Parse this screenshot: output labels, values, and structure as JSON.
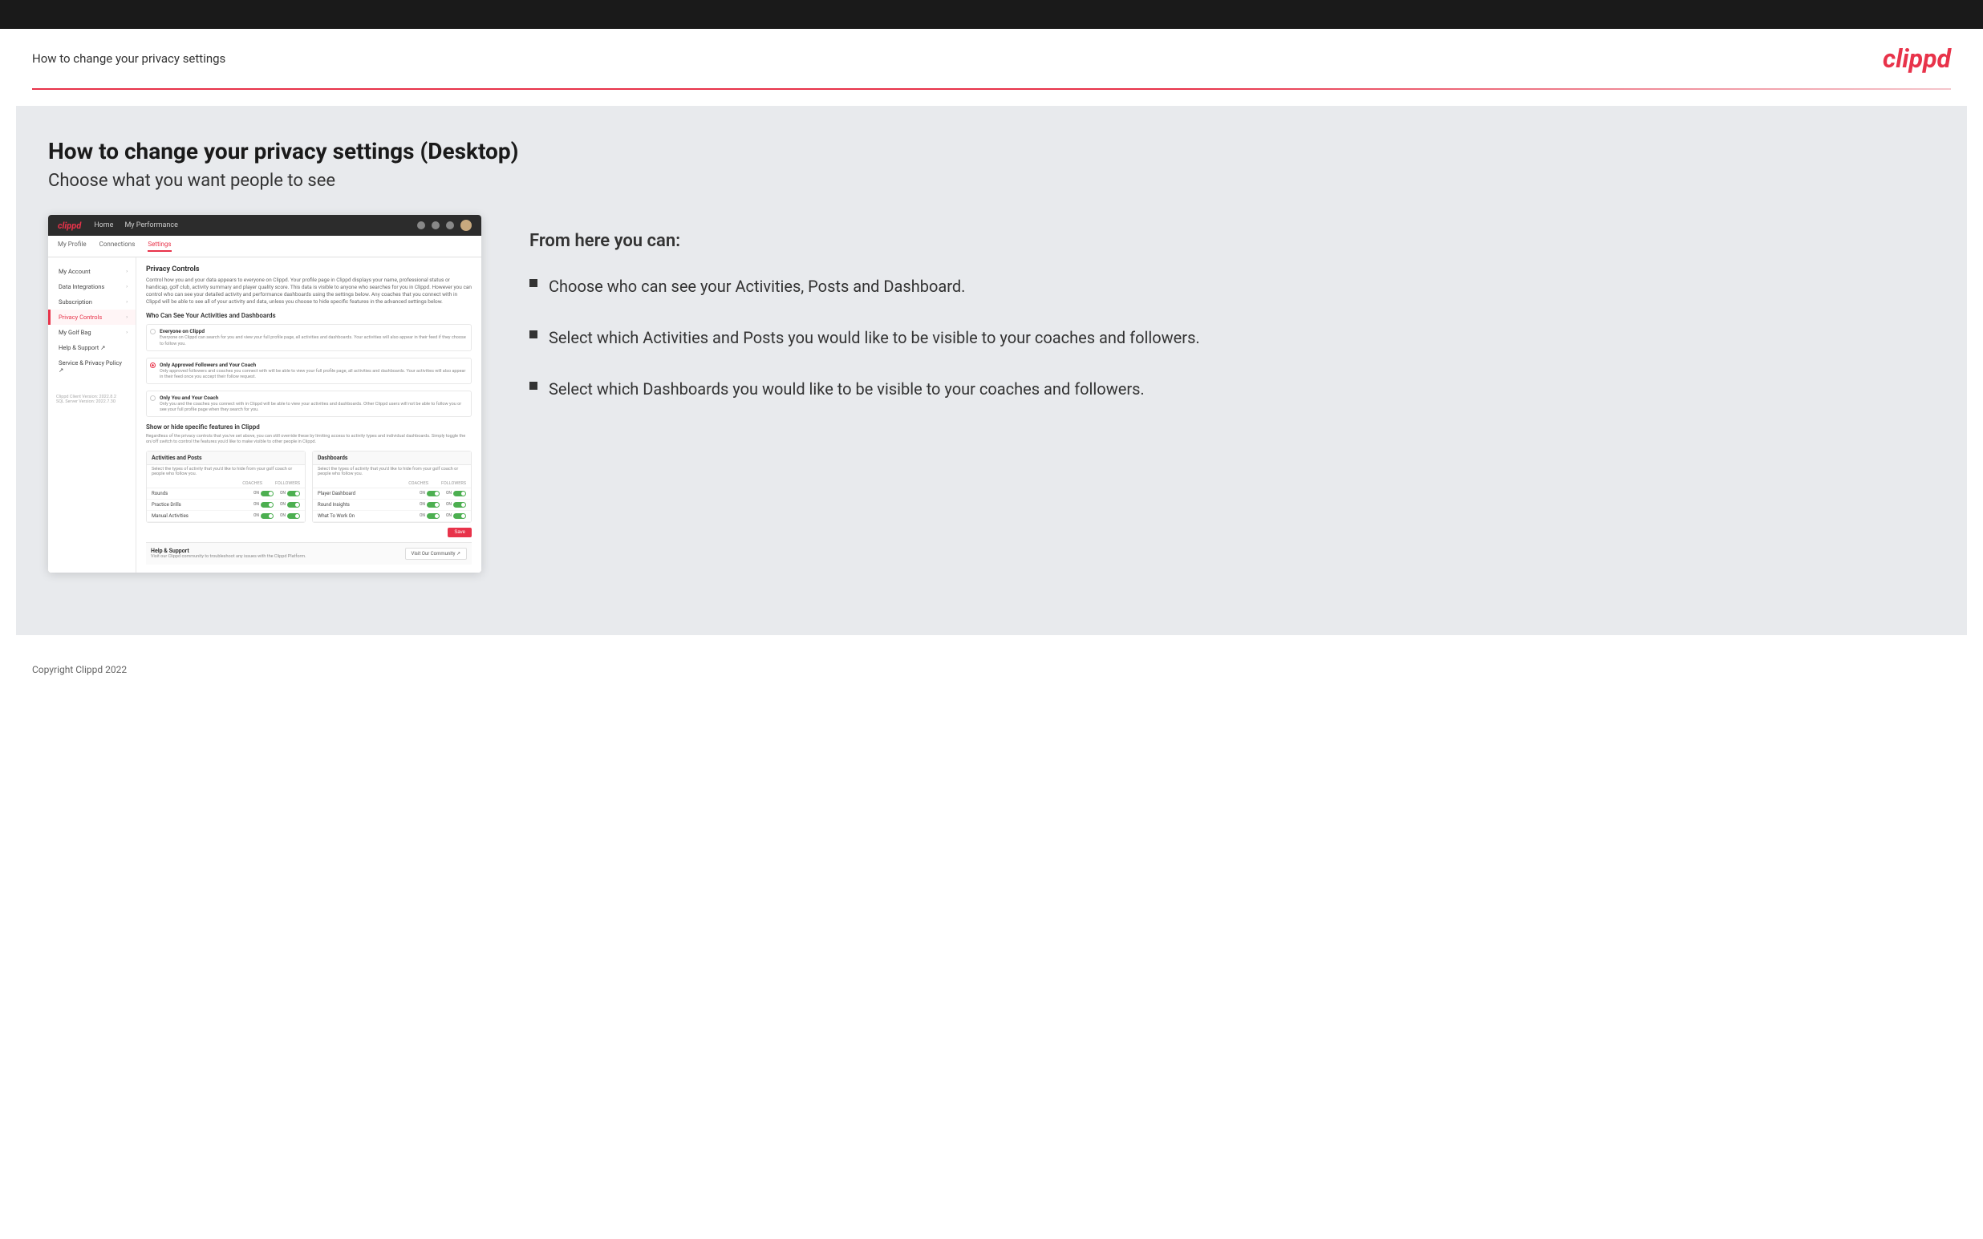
{
  "topBar": {},
  "header": {
    "title": "How to change your privacy settings",
    "logo": "clippd"
  },
  "main": {
    "pageTitle": "How to change your privacy settings (Desktop)",
    "pageSubtitle": "Choose what you want people to see",
    "rightPanel": {
      "fromHereTitle": "From here you can:",
      "bullets": [
        "Choose who can see your Activities, Posts and Dashboard.",
        "Select which Activities and Posts you would like to be visible to your coaches and followers.",
        "Select which Dashboards you would like to be visible to your coaches and followers."
      ]
    }
  },
  "mockup": {
    "navbar": {
      "logo": "clippd",
      "links": [
        "Home",
        "My Performance"
      ]
    },
    "subnav": {
      "items": [
        "My Profile",
        "Connections",
        "Settings"
      ]
    },
    "sidebar": {
      "items": [
        {
          "label": "My Account",
          "active": false
        },
        {
          "label": "Data Integrations",
          "active": false
        },
        {
          "label": "Subscription",
          "active": false
        },
        {
          "label": "Privacy Controls",
          "active": true
        },
        {
          "label": "My Golf Bag",
          "active": false
        },
        {
          "label": "Help & Support",
          "active": false
        },
        {
          "label": "Service & Privacy Policy",
          "active": false
        }
      ],
      "version": "Clippd Client Version: 2022.8.2\nSQL Server Version: 2022.7.30"
    },
    "privacyControls": {
      "sectionTitle": "Privacy Controls",
      "sectionDesc": "Control how you and your data appears to everyone on Clippd. Your profile page in Clippd displays your name, professional status or handicap, golf club, activity summary and player quality score. This data is visible to anyone who searches for you in Clippd. However you can control who can see your detailed activity and performance dashboards using the settings below. Any coaches that you connect with in Clippd will be able to see all of your activity and data, unless you choose to hide specific features in the advanced settings below.",
      "whoTitle": "Who Can See Your Activities and Dashboards",
      "radioOptions": [
        {
          "label": "Everyone on Clippd",
          "desc": "Everyone on Clippd can search for you and view your full profile page, all activities and dashboards. Your activities will also appear in their feed if they choose to follow you.",
          "selected": false
        },
        {
          "label": "Only Approved Followers and Your Coach",
          "desc": "Only approved followers and coaches you connect with will be able to view your full profile page, all activities and dashboards. Your activities will also appear in their feed once you accept their follow request.",
          "selected": true
        },
        {
          "label": "Only You and Your Coach",
          "desc": "Only you and the coaches you connect with in Clippd will be able to view your activities and dashboards. Other Clippd users will not be able to follow you or see your full profile page when they search for you.",
          "selected": false
        }
      ],
      "showHideTitle": "Show or hide specific features in Clippd",
      "showHideDesc": "Regardless of the privacy controls that you've set above, you can still override these by limiting access to activity types and individual dashboards. Simply toggle the on/off switch to control the features you'd like to make visible to other people in Clippd.",
      "activitiesTable": {
        "title": "Activities and Posts",
        "desc": "Select the types of activity that you'd like to hide from your golf coach or people who follow you.",
        "cols": [
          "COACHES",
          "FOLLOWERS"
        ],
        "rows": [
          {
            "label": "Rounds",
            "coaches": "ON",
            "followers": "ON"
          },
          {
            "label": "Practice Drills",
            "coaches": "ON",
            "followers": "ON"
          },
          {
            "label": "Manual Activities",
            "coaches": "ON",
            "followers": "ON"
          }
        ]
      },
      "dashboardsTable": {
        "title": "Dashboards",
        "desc": "Select the types of activity that you'd like to hide from your golf coach or people who follow you.",
        "cols": [
          "COACHES",
          "FOLLOWERS"
        ],
        "rows": [
          {
            "label": "Player Dashboard",
            "coaches": "ON",
            "followers": "ON"
          },
          {
            "label": "Round Insights",
            "coaches": "ON",
            "followers": "ON"
          },
          {
            "label": "What To Work On",
            "coaches": "ON",
            "followers": "ON"
          }
        ]
      },
      "saveButton": "Save"
    },
    "helpSection": {
      "title": "Help & Support",
      "desc": "Visit our Clippd community to troubleshoot any issues with the Clippd Platform.",
      "buttonLabel": "Visit Our Community"
    }
  },
  "footer": {
    "copyright": "Copyright Clippd 2022"
  }
}
